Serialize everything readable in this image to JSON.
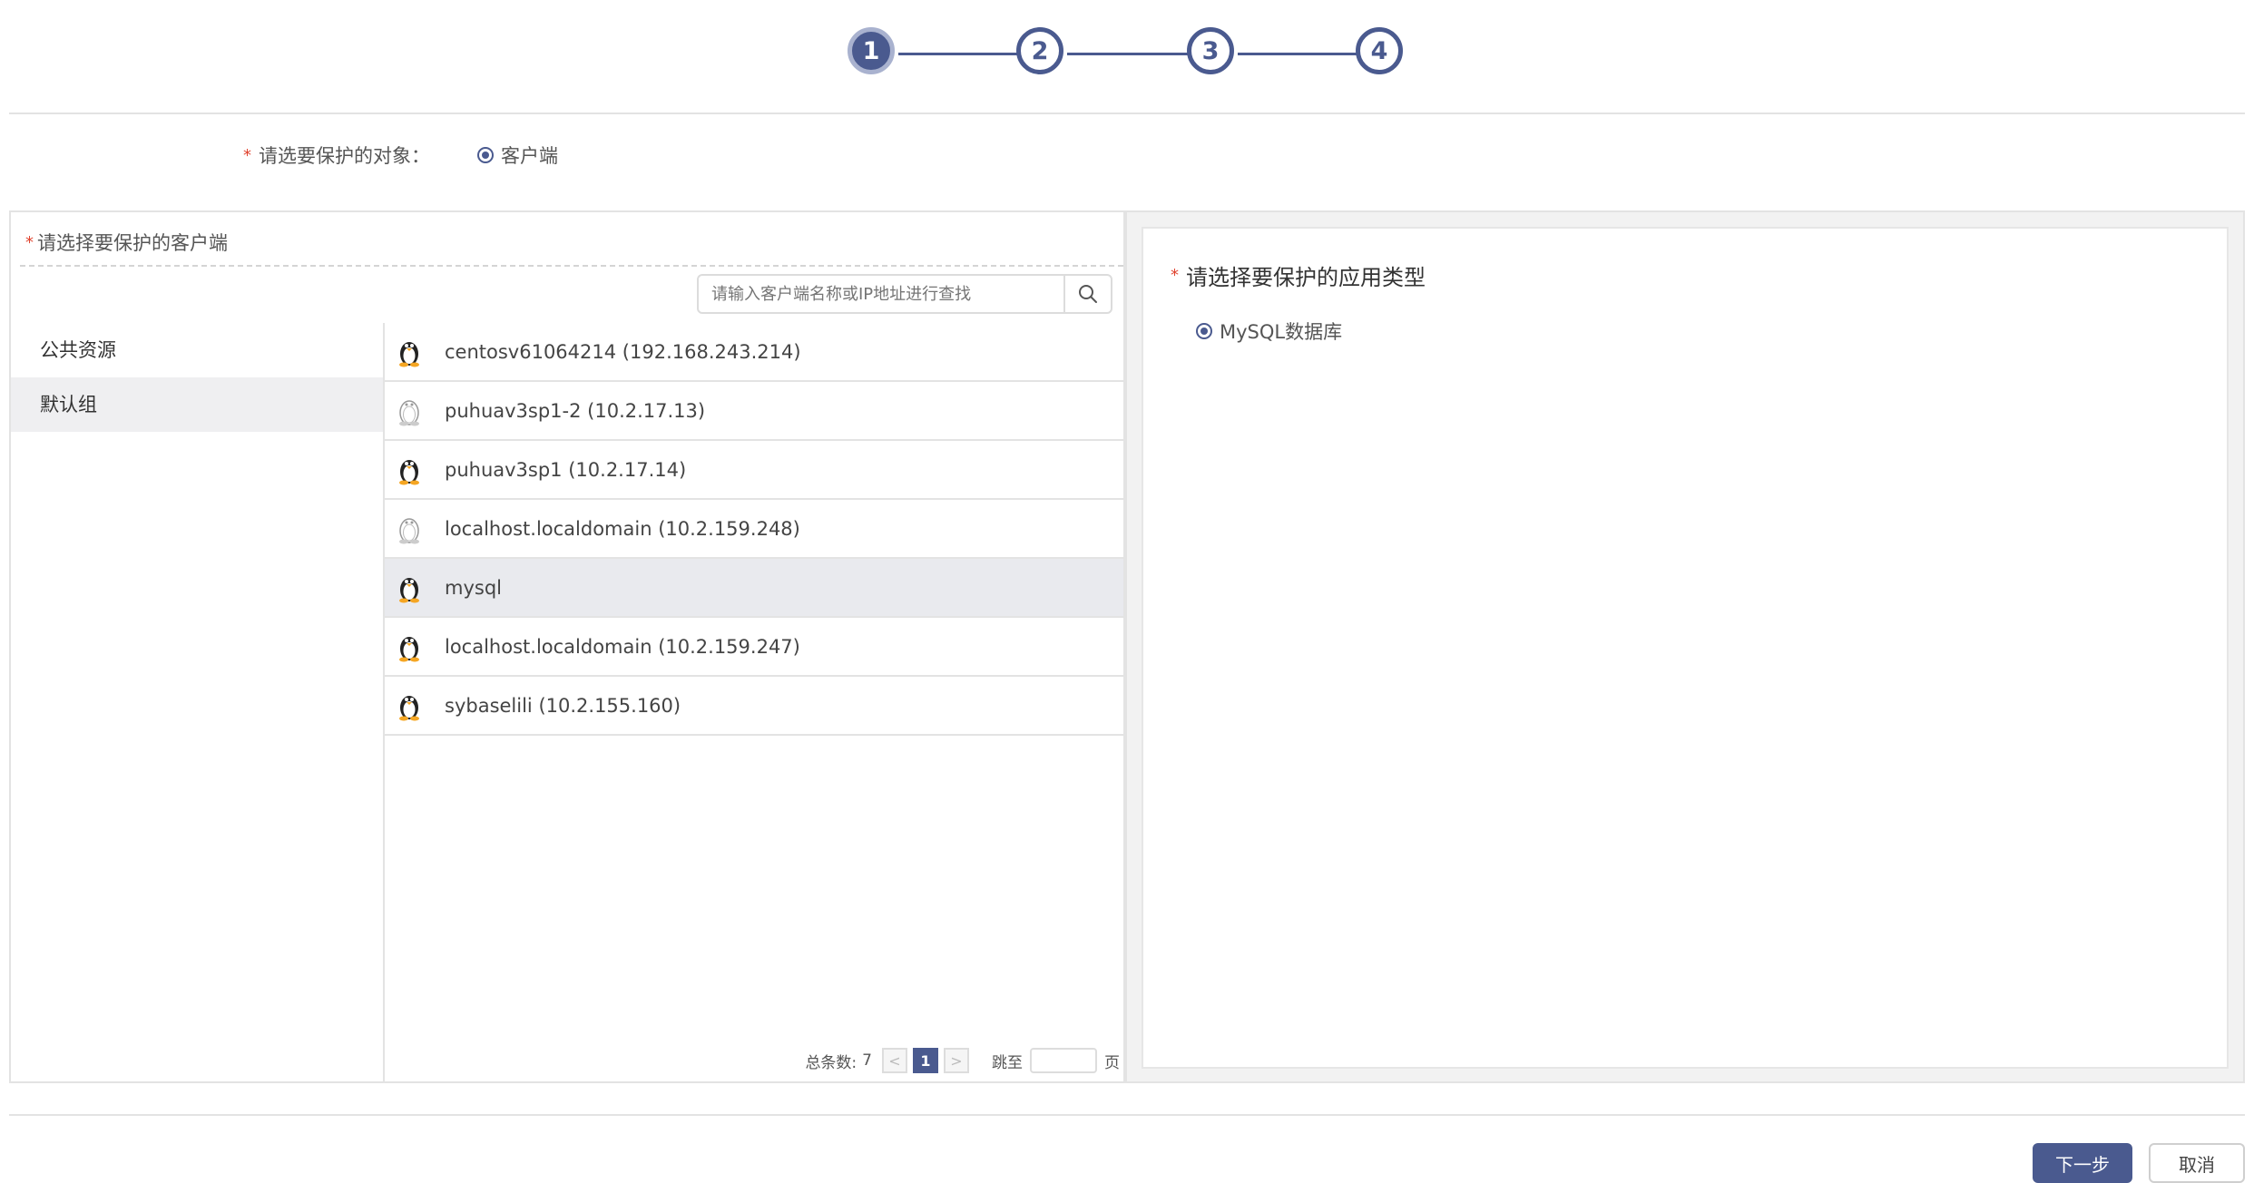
{
  "stepper": {
    "steps": [
      "1",
      "2",
      "3",
      "4"
    ],
    "active": 1
  },
  "object_row": {
    "required_mark": "*",
    "label": "请选要保护的对象：",
    "option": "客户端"
  },
  "client_panel": {
    "required_mark": "*",
    "title": "请选择要保护的客户端",
    "search_placeholder": "请输入客户端名称或IP地址进行查找",
    "groups": [
      {
        "label": "公共资源",
        "selected": false
      },
      {
        "label": "默认组",
        "selected": true
      }
    ],
    "clients": [
      {
        "label": "centosv61064214 (192.168.243.214)",
        "icon": "linux-penguin-icon",
        "online": true
      },
      {
        "label": "puhuav3sp1-2 (10.2.17.13)",
        "icon": "linux-penguin-icon",
        "online": false
      },
      {
        "label": "puhuav3sp1 (10.2.17.14)",
        "icon": "linux-penguin-icon",
        "online": true
      },
      {
        "label": "localhost.localdomain (10.2.159.248)",
        "icon": "linux-penguin-icon",
        "online": false
      },
      {
        "label": "mysql",
        "icon": "linux-penguin-icon",
        "online": true,
        "selected": true
      },
      {
        "label": "localhost.localdomain (10.2.159.247)",
        "icon": "linux-penguin-icon",
        "online": true
      },
      {
        "label": "sybaselili (10.2.155.160)",
        "icon": "linux-penguin-icon",
        "online": true
      }
    ],
    "pagination": {
      "total_label": "总条数:",
      "total": "7",
      "prev": "<",
      "current_page": "1",
      "next": ">",
      "jump_label": "跳至",
      "page_unit": "页"
    }
  },
  "app_panel": {
    "required_mark": "*",
    "title": "请选择要保护的应用类型",
    "options": [
      "MySQL数据库"
    ]
  },
  "footer": {
    "next_label": "下一步",
    "cancel_label": "取消"
  },
  "colors": {
    "primary": "#4a5a8f",
    "required": "#e0432e",
    "border": "#e3e3e3"
  }
}
